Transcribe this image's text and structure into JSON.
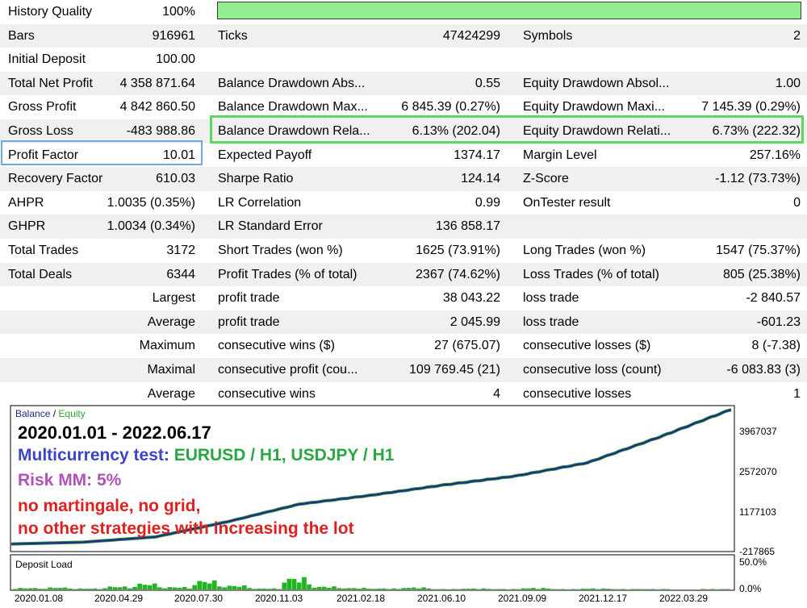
{
  "report": {
    "history_quality": {
      "label": "History Quality",
      "value": "100%",
      "bar_fill": 1.0
    },
    "rows": [
      {
        "l1": "Bars",
        "v1": "916961",
        "l2": "Ticks",
        "v2": "47424299",
        "l3": "Symbols",
        "v3": "2"
      },
      {
        "l1": "Initial Deposit",
        "v1": "100.00",
        "l2": "",
        "v2": "",
        "l3": "",
        "v3": ""
      },
      {
        "l1": "Total Net Profit",
        "v1": "4 358 871.64",
        "l2": "Balance Drawdown Abs...",
        "v2": "0.55",
        "l3": "Equity Drawdown Absol...",
        "v3": "1.00"
      },
      {
        "l1": "Gross Profit",
        "v1": "4 842 860.50",
        "l2": "Balance Drawdown Max...",
        "v2": "6 845.39 (0.27%)",
        "l3": "Equity Drawdown Maxi...",
        "v3": "7 145.39 (0.29%)"
      },
      {
        "l1": "Gross Loss",
        "v1": "-483 988.86",
        "l2": "Balance Drawdown Rela...",
        "v2": "6.13% (202.04)",
        "l3": "Equity Drawdown Relati...",
        "v3": "6.73% (222.32)"
      },
      {
        "l1": "Profit Factor",
        "v1": "10.01",
        "l2": "Expected Payoff",
        "v2": "1374.17",
        "l3": "Margin Level",
        "v3": "257.16%"
      },
      {
        "l1": "Recovery Factor",
        "v1": "610.03",
        "l2": "Sharpe Ratio",
        "v2": "124.14",
        "l3": "Z-Score",
        "v3": "-1.12 (73.73%)"
      },
      {
        "l1": "AHPR",
        "v1": "1.0035 (0.35%)",
        "l2": "LR Correlation",
        "v2": "0.99",
        "l3": "OnTester result",
        "v3": "0"
      },
      {
        "l1": "GHPR",
        "v1": "1.0034 (0.34%)",
        "l2": "LR Standard Error",
        "v2": "136 858.17",
        "l3": "",
        "v3": ""
      },
      {
        "l1": "Total Trades",
        "v1": "3172",
        "l2": "Short Trades (won %)",
        "v2": "1625 (73.91%)",
        "l3": "Long Trades (won %)",
        "v3": "1547 (75.37%)"
      },
      {
        "l1": "Total Deals",
        "v1": "6344",
        "l2": "Profit Trades (% of total)",
        "v2": "2367 (74.62%)",
        "l3": "Loss Trades (% of total)",
        "v3": "805 (25.38%)"
      },
      {
        "l1": "",
        "v1": "Largest",
        "l2": "profit trade",
        "v2": "38 043.22",
        "l3": "loss trade",
        "v3": "-2 840.57"
      },
      {
        "l1": "",
        "v1": "Average",
        "l2": "profit trade",
        "v2": "2 045.99",
        "l3": "loss trade",
        "v3": "-601.23"
      },
      {
        "l1": "",
        "v1": "Maximum",
        "l2": "consecutive wins ($)",
        "v2": "27 (675.07)",
        "l3": "consecutive losses ($)",
        "v3": "8 (-7.38)"
      },
      {
        "l1": "",
        "v1": "Maximal",
        "l2": "consecutive profit (cou...",
        "v2": "109 769.45 (21)",
        "l3": "consecutive loss (count)",
        "v3": "-6 083.83 (3)"
      },
      {
        "l1": "",
        "v1": "Average",
        "l2": "consecutive wins",
        "v2": "4",
        "l3": "consecutive losses",
        "v3": "1"
      }
    ]
  },
  "chart": {
    "legend": {
      "balance": "Balance",
      "separator": " / ",
      "equity": "Equity"
    },
    "annotations": {
      "dates": "2020.01.01 - 2022.06.17",
      "multi_prefix": "Multicurrency test: ",
      "multi_pairs": "EURUSD / H1, USDJPY / H1",
      "risk": "Risk MM: 5%",
      "no_mart": "no martingale, no grid,",
      "no_other": "no other strategies with increasing the lot"
    },
    "y_ticks": [
      "3967037",
      "2572070",
      "1177103",
      "-217865"
    ],
    "deposit_load": {
      "label": "Deposit Load",
      "ticks": [
        "50.0%",
        "0.0%"
      ]
    },
    "x_ticks": [
      "2020.01.08",
      "2020.04.29",
      "2020.07.30",
      "2020.11.03",
      "2021.02.18",
      "2021.06.10",
      "2021.09.09",
      "2021.12.17",
      "2022.03.29"
    ],
    "colors": {
      "balance": "#1c2a8f",
      "equity": "#2e8b3c",
      "load": "#22b522"
    }
  },
  "chart_data": {
    "type": "line",
    "title": "2020.01.01 - 2022.06.17",
    "xlabel": "",
    "ylabel": "",
    "x": [
      "2020.01.01",
      "2020.01.08",
      "2020.04.29",
      "2020.07.30",
      "2020.11.03",
      "2021.02.18",
      "2021.06.10",
      "2021.09.09",
      "2021.12.17",
      "2022.03.29",
      "2022.06.17"
    ],
    "ylim": [
      -217865,
      4300000
    ],
    "series": [
      {
        "name": "Balance",
        "values": [
          100,
          60000,
          230000,
          720000,
          1290000,
          1580000,
          1910000,
          2200000,
          2630000,
          3460000,
          4358971
        ]
      },
      {
        "name": "Equity",
        "values": [
          100,
          60000,
          230000,
          720000,
          1290000,
          1580000,
          1910000,
          2200000,
          2630000,
          3460000,
          4358971
        ]
      }
    ],
    "deposit_load": {
      "ylim": [
        0,
        50
      ],
      "values": [
        3,
        4,
        2,
        6,
        12,
        5,
        18,
        8,
        2,
        24,
        6,
        3,
        2,
        4,
        1,
        2,
        1,
        3,
        1,
        2,
        1,
        1,
        0,
        1
      ]
    },
    "legend": "top-left",
    "grid": false
  }
}
